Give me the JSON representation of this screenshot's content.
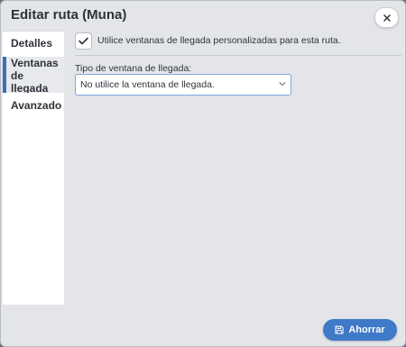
{
  "dialog": {
    "title": "Editar ruta (Muna)",
    "close_icon": "close-icon"
  },
  "sidebar": {
    "items": [
      {
        "label": "Detalles",
        "selected": false
      },
      {
        "label": "Ventanas de llegada",
        "selected": true
      },
      {
        "label": "Avanzado",
        "selected": false
      }
    ]
  },
  "main": {
    "custom_windows_checkbox": {
      "checked": true,
      "label": "Utilice ventanas de llegada personalizadas para esta ruta."
    },
    "window_type": {
      "label": "Tipo de ventana de llegada:",
      "selected_value": "No utilice la ventana de llegada."
    }
  },
  "footer": {
    "save_label": "Ahorrar",
    "save_icon": "floppy-disk-icon"
  },
  "colors": {
    "accent": "#3f79c7",
    "selected_indicator": "#3b6fb6"
  }
}
